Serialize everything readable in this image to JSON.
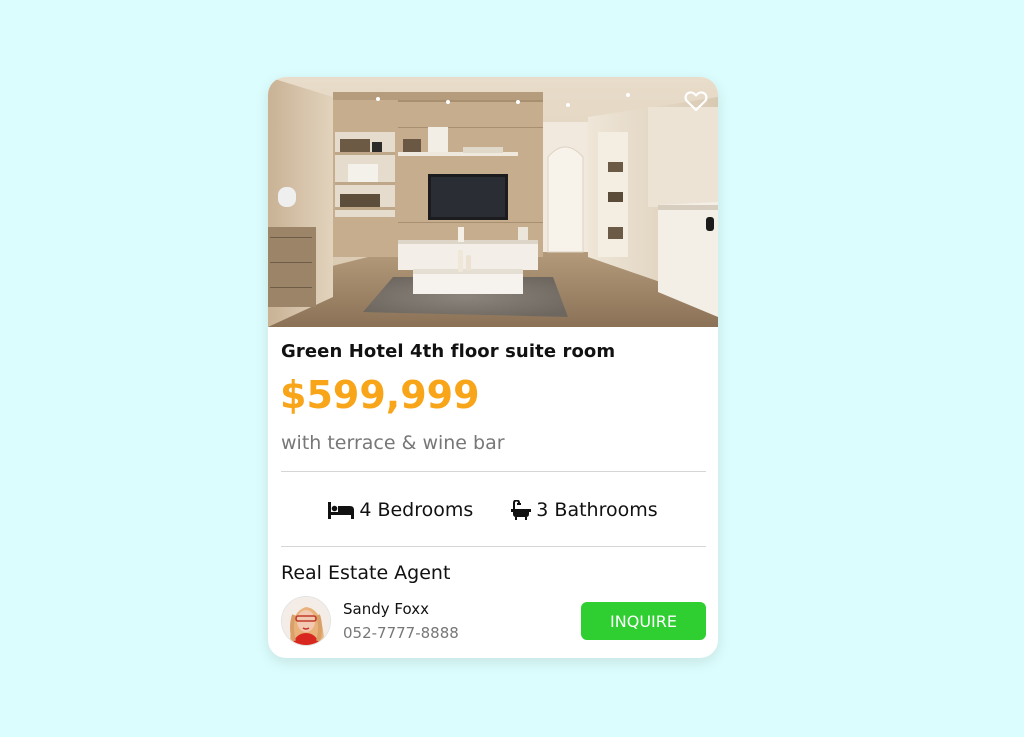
{
  "listing": {
    "title": "Green Hotel 4th floor suite room",
    "price": "$599,999",
    "subtitle": "with terrace & wine bar",
    "favorite_icon": "heart-icon",
    "features": [
      {
        "icon": "bed-icon",
        "label": "4 Bedrooms"
      },
      {
        "icon": "bathtub-icon",
        "label": "3 Bathrooms"
      }
    ]
  },
  "agent": {
    "heading": "Real Estate Agent",
    "name": "Sandy Foxx",
    "phone": "052-7777-8888",
    "inquire_label": "INQUIRE"
  },
  "colors": {
    "background": "#dcfdfd",
    "price": "#f8a51a",
    "button": "#2fce31"
  }
}
